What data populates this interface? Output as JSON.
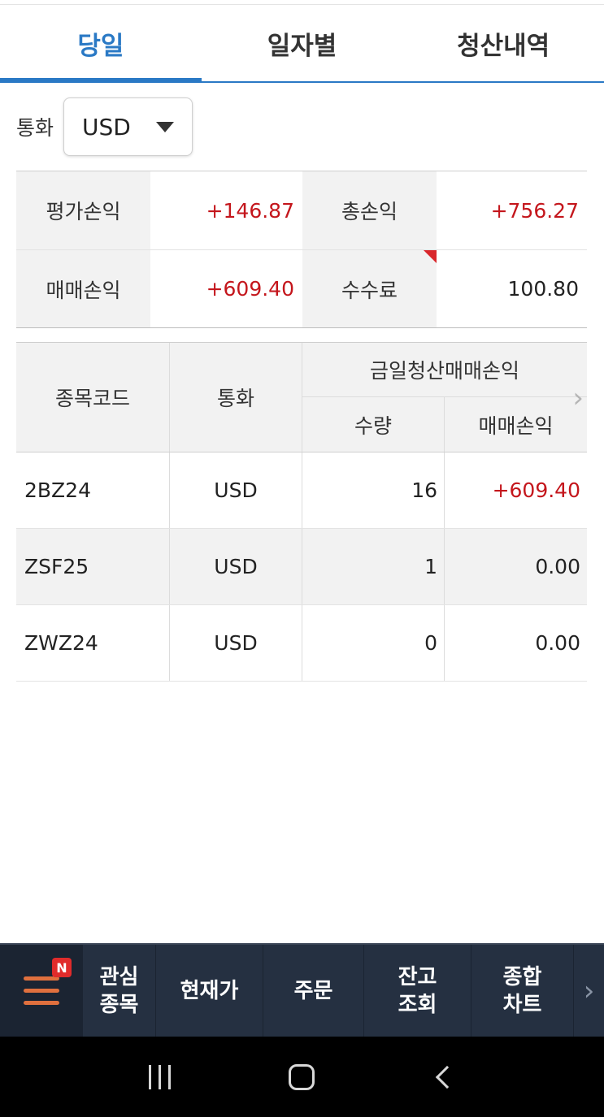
{
  "tabs": [
    {
      "label": "당일",
      "active": true
    },
    {
      "label": "일자별",
      "active": false
    },
    {
      "label": "청산내역",
      "active": false
    }
  ],
  "currency": {
    "label": "통화",
    "selected": "USD"
  },
  "summary": {
    "row1": {
      "label_a": "평가손익",
      "value_a": "+146.87",
      "label_b": "총손익",
      "value_b": "+756.27"
    },
    "row2": {
      "label_a": "매매손익",
      "value_a": "+609.40",
      "label_b": "수수료",
      "value_b": "100.80"
    }
  },
  "positions": {
    "headers": {
      "code": "종목코드",
      "currency": "통화",
      "group": "금일청산매매손익",
      "qty": "수량",
      "pnl": "매매손익"
    },
    "rows": [
      {
        "code": "2BZ24",
        "currency": "USD",
        "qty": "16",
        "pnl": "+609.40"
      },
      {
        "code": "ZSF25",
        "currency": "USD",
        "qty": "1",
        "pnl": "0.00"
      },
      {
        "code": "ZWZ24",
        "currency": "USD",
        "qty": "0",
        "pnl": "0.00"
      }
    ]
  },
  "bottom_nav": {
    "badge": "N",
    "items": [
      {
        "line1": "관심",
        "line2": "종목"
      },
      {
        "line1": "현재가",
        "line2": ""
      },
      {
        "line1": "주문",
        "line2": ""
      },
      {
        "line1": "잔고",
        "line2": "조회"
      },
      {
        "line1": "종합",
        "line2": "차트"
      }
    ]
  },
  "colors": {
    "accent": "#2a79c5",
    "positive": "#c4161c",
    "nav_bg": "#253041",
    "menu_icon": "#e0703e"
  }
}
